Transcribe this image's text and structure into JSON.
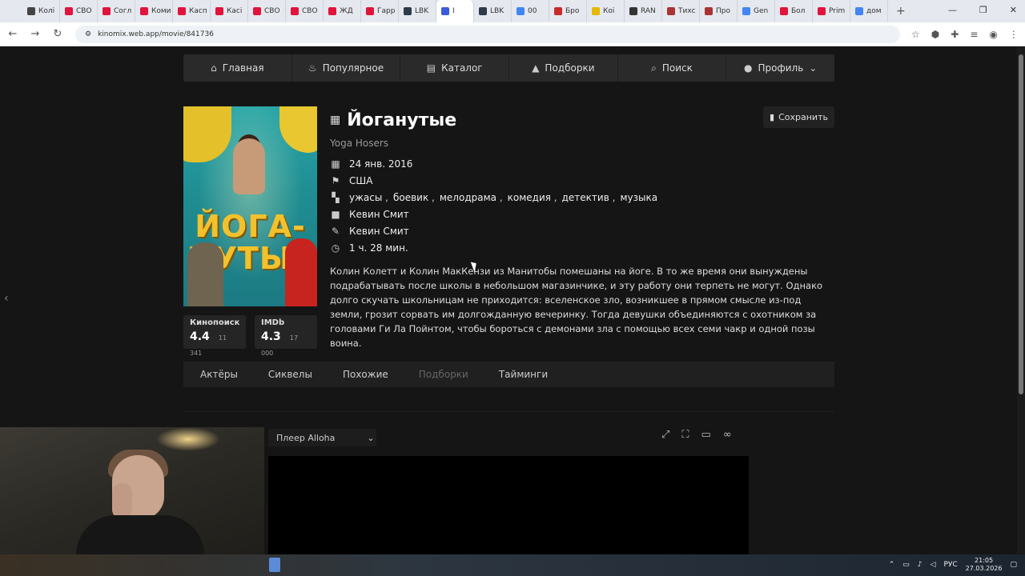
{
  "browser": {
    "tabs": [
      {
        "label": "Колі",
        "color": "#444"
      },
      {
        "label": "СВО",
        "color": "#e0143c"
      },
      {
        "label": "Согл",
        "color": "#e0143c"
      },
      {
        "label": "Коми",
        "color": "#e0143c"
      },
      {
        "label": "Касп",
        "color": "#e0143c"
      },
      {
        "label": "Касі",
        "color": "#e0143c"
      },
      {
        "label": "СВО",
        "color": "#e0143c"
      },
      {
        "label": "СВО",
        "color": "#e0143c"
      },
      {
        "label": "ЖД",
        "color": "#e0143c"
      },
      {
        "label": "Гарр",
        "color": "#e0143c"
      },
      {
        "label": "LBK",
        "color": "#2d3a4a"
      },
      {
        "label": "I",
        "color": "#3b5bdb"
      },
      {
        "label": "LBK",
        "color": "#2d3a4a"
      },
      {
        "label": "00",
        "color": "#4285f4"
      },
      {
        "label": "Бро",
        "color": "#c92a2a"
      },
      {
        "label": "Коі",
        "color": "#e6b800"
      },
      {
        "label": "RAN",
        "color": "#333"
      },
      {
        "label": "Тихс",
        "color": "#a33"
      },
      {
        "label": "Про",
        "color": "#a33"
      },
      {
        "label": "Gen",
        "color": "#4285f4"
      },
      {
        "label": "Бол",
        "color": "#e0143c"
      },
      {
        "label": "Prim",
        "color": "#e0143c"
      },
      {
        "label": "дом",
        "color": "#4285f4"
      }
    ],
    "url": "kinomix.web.app/movie/841736"
  },
  "nav": {
    "home": "Главная",
    "popular": "Популярное",
    "catalog": "Каталог",
    "collections": "Подборки",
    "search": "Поиск",
    "profile": "Профиль"
  },
  "movie": {
    "title": "Йоганутые",
    "original_title": "Yoga Hosers",
    "poster_title_line1": "ЙОГА-",
    "poster_title_line2": "НУТЫЕ",
    "save_label": "Сохранить",
    "release_date": "24 янв. 2016",
    "country": "США",
    "genres": [
      "ужасы",
      "боевик",
      "мелодрама",
      "комедия",
      "детектив",
      "музыка"
    ],
    "director": "Кевин Смит",
    "writer": "Кевин Смит",
    "duration": "1 ч. 28 мин.",
    "description": "Колин Колетт и Колин МакКензи из Манитобы помешаны на йоге. В то же время они вынуждены подрабатывать после школы в небольшом магазинчике, и эту работу они терпеть не могут. Однако долго скучать школьницам не приходится: вселенское зло, возникшее в прямом смысле из-под земли, грозит сорвать им долгожданную вечеринку. Тогда девушки объединяются с охотником за головами Ги Ла Пойнтом, чтобы бороться с демонами зла с помощью всех семи чакр и одной позы воина."
  },
  "ratings": {
    "kinopoisk": {
      "label": "Кинопоиск",
      "value": "4.4",
      "votes": "11 341"
    },
    "imdb": {
      "label": "IMDb",
      "value": "4.3",
      "votes": "17 000"
    }
  },
  "tabs": {
    "actors": "Актёры",
    "sequels": "Сиквелы",
    "similar": "Похожие",
    "collections": "Подборки",
    "timings": "Тайминги"
  },
  "player": {
    "selected": "Плеер Alloha"
  },
  "taskbar": {
    "lang": "РУС",
    "time": "21:05",
    "date": "27.03.2026"
  }
}
